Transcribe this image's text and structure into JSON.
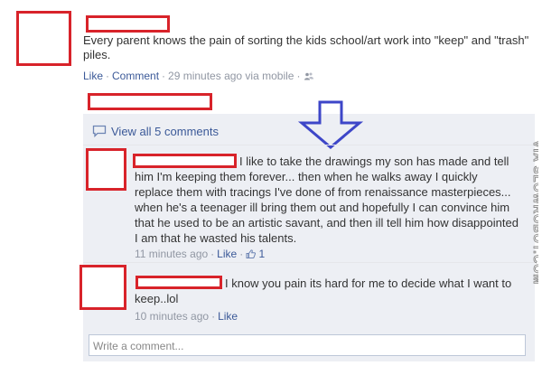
{
  "post": {
    "text": "Every parent knows the pain of sorting the kids school/art work into \"keep\" and \"trash\" piles.",
    "actions": {
      "like": "Like",
      "comment": "Comment",
      "time": "29 minutes ago via mobile"
    }
  },
  "view_all": {
    "label": "View all 5 comments"
  },
  "comments": [
    {
      "text": "I like to take the drawings my son has made and tell him I'm keeping them forever... then when he walks away I quickly replace them with tracings I've done of from renaissance masterpieces... when he's a teenager ill bring them out and hopefully I can convince him that he used to be an artistic savant, and then ill tell him how disappointed I am that he wasted his talents.",
      "time": "11 minutes ago",
      "like": "Like",
      "like_count": "1"
    },
    {
      "text": "I know you pain its hard for me to decide what I want to keep..lol",
      "time": "10 minutes ago",
      "like": "Like"
    }
  ],
  "composer": {
    "placeholder": "Write a comment..."
  },
  "watermark": "VIA SLOWROBOT.COM",
  "colors": {
    "redaction": "#d8232a",
    "link": "#3b5998",
    "arrow": "#3d46c8",
    "panel": "#edeff4",
    "meta": "#9197a3"
  },
  "icons": [
    "comment-bubble-icon",
    "people-icon",
    "thumbs-up-icon",
    "down-arrow-annotation"
  ]
}
